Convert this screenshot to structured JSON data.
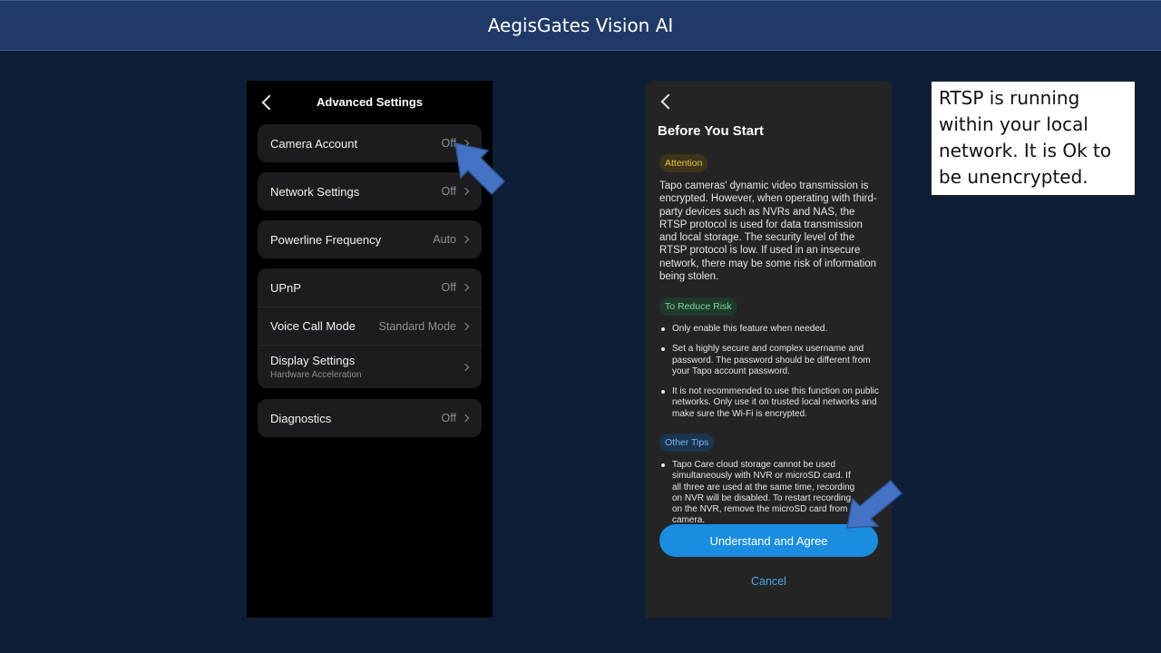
{
  "banner": {
    "title": "AegisGates Vision AI"
  },
  "left_screen": {
    "title": "Advanced Settings",
    "groups": [
      [
        {
          "label": "Camera Account",
          "value": "Off"
        }
      ],
      [
        {
          "label": "Network Settings",
          "value": "Off"
        }
      ],
      [
        {
          "label": "Powerline Frequency",
          "value": "Auto"
        }
      ],
      [
        {
          "label": "UPnP",
          "value": "Off"
        },
        {
          "label": "Voice Call Mode",
          "value": "Standard Mode"
        },
        {
          "label": "Display Settings",
          "sublabel": "Hardware Acceleration",
          "value": ""
        }
      ],
      [
        {
          "label": "Diagnostics",
          "value": "Off"
        }
      ]
    ]
  },
  "right_screen": {
    "title": "Before You Start",
    "attention_label": "Attention",
    "attention_text": "Tapo cameras' dynamic video transmission is encrypted. However, when operating with third-party devices such as NVRs and NAS, the RTSP protocol is used for data transmission and local storage. The security level of the RTSP protocol is low. If used in an insecure network, there may be some risk of information being stolen.",
    "reduce_label": "To Reduce Risk",
    "reduce_items": [
      "Only enable this feature when needed.",
      "Set a highly secure and complex username and password. The password should be different from your Tapo account password.",
      "It is not recommended to use this function on public networks. Only use it on trusted local networks and make sure the Wi-Fi is encrypted."
    ],
    "tips_label": "Other Tips",
    "tips_items": [
      "Tapo Care cloud storage cannot be used simultaneously with NVR or microSD card. If all three are used at the same time, recording on NVR will be disabled. To restart recording on the NVR, remove the microSD card from camera."
    ],
    "agree_button": "Understand and Agree",
    "cancel_button": "Cancel"
  },
  "note": {
    "text": "RTSP is running within your local network. It is Ok to be unencrypted."
  },
  "colors": {
    "background": "#0f1e37",
    "banner": "#1f3a66",
    "annotation_arrow": "#4472c4",
    "primary_button": "#1a8de0"
  }
}
